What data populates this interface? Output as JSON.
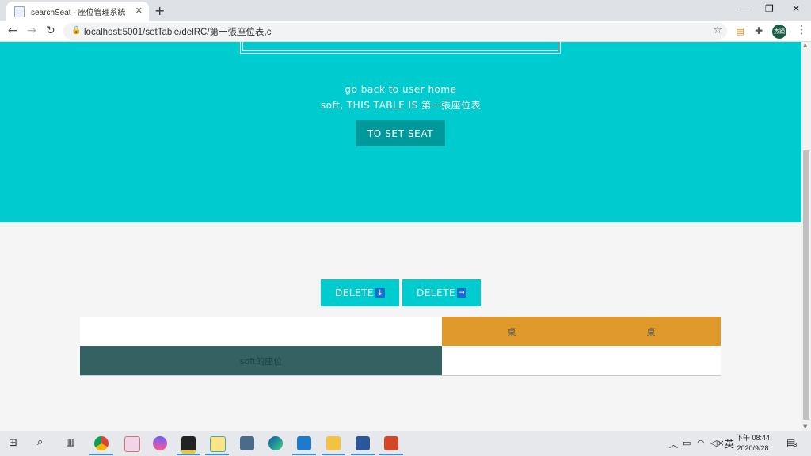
{
  "browser": {
    "tab_title": "searchSeat - 座位管理系統",
    "tab_close": "✕",
    "new_tab": "+",
    "url": "localhost:5001/setTable/delRC/第一張座位表,c",
    "profile_label": "杰穎",
    "minimize": "—",
    "restore": "❐",
    "close": "✕"
  },
  "hero": {
    "back_link": "go back to user home",
    "table_label": "soft, THIS TABLE IS 第一張座位表",
    "set_seat_button": "TO SET SEAT"
  },
  "actions": {
    "delete_row_label": "DELETE",
    "delete_row_arrow": "↓",
    "delete_col_label": "DELETE",
    "delete_col_arrow": "→"
  },
  "seat_table": {
    "row1": {
      "left": "",
      "mid": "桌",
      "right": "桌"
    },
    "row2": {
      "left": "soft的座位",
      "right": ""
    }
  },
  "colors": {
    "hero_bg": "#00cccf",
    "set_seat_bg": "#00999b",
    "desk_orange": "#e09a2b",
    "seat_dark": "#346262",
    "arrow_blue": "#1a6bd1"
  },
  "taskbar": {
    "ime": "英",
    "time": "下午 08:44",
    "date": "2020/9/28",
    "notifications": "3"
  }
}
